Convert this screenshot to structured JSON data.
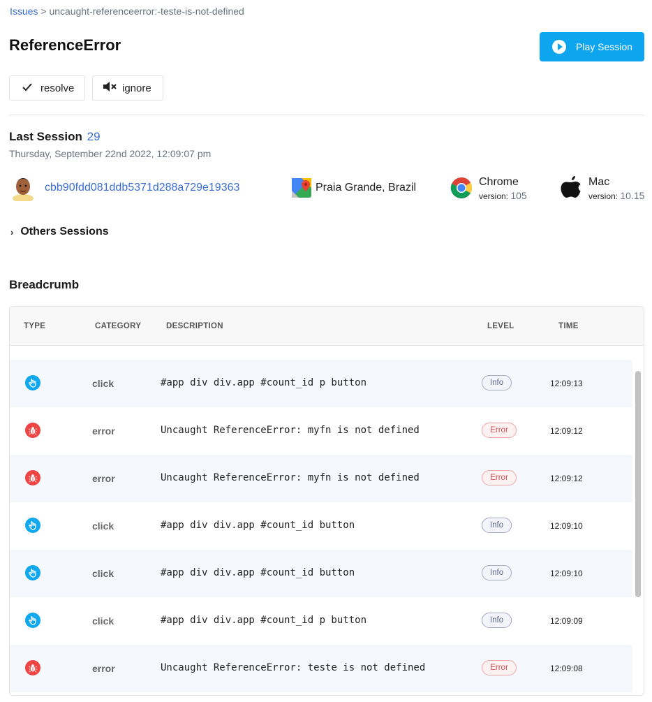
{
  "breadcrumb": {
    "root": "Issues",
    "separator": " > ",
    "current": "uncaught-referenceerror:-teste-is-not-defined"
  },
  "page_title": "ReferenceError",
  "header": {
    "play_label": "Play Session"
  },
  "actions": {
    "resolve_label": "resolve",
    "ignore_label": "ignore"
  },
  "session": {
    "heading": "Last Session",
    "count": "29",
    "date": "Thursday, September 22nd 2022, 12:09:07 pm",
    "user_id": "cbb90fdd081ddb5371d288a729e19363",
    "location": "Praia Grande, Brazil",
    "browser": {
      "name": "Chrome",
      "version_label": "version:",
      "version": "105"
    },
    "os": {
      "name": "Mac",
      "version_label": "version:",
      "version": "10.15"
    }
  },
  "others_label": "Others Sessions",
  "breadcrumb_section": {
    "title": "Breadcrumb",
    "columns": {
      "type": "TYPE",
      "category": "CATEGORY",
      "description": "DESCRIPTION",
      "level": "LEVEL",
      "time": "TIME"
    },
    "rows": [
      {
        "type": "click",
        "category": "click",
        "description": "#app div div.app #count_id p button",
        "level": "Info",
        "time": "12:09:13"
      },
      {
        "type": "error",
        "category": "error",
        "description": "Uncaught ReferenceError: myfn is not defined",
        "level": "Error",
        "time": "12:09:12"
      },
      {
        "type": "error",
        "category": "error",
        "description": "Uncaught ReferenceError: myfn is not defined",
        "level": "Error",
        "time": "12:09:12"
      },
      {
        "type": "click",
        "category": "click",
        "description": "#app div div.app #count_id button",
        "level": "Info",
        "time": "12:09:10"
      },
      {
        "type": "click",
        "category": "click",
        "description": "#app div div.app #count_id button",
        "level": "Info",
        "time": "12:09:10"
      },
      {
        "type": "click",
        "category": "click",
        "description": "#app div div.app #count_id p button",
        "level": "Info",
        "time": "12:09:09"
      },
      {
        "type": "error",
        "category": "error",
        "description": "Uncaught ReferenceError: teste is not defined",
        "level": "Error",
        "time": "12:09:08"
      }
    ]
  },
  "colors": {
    "accent": "#0ea5ef",
    "link": "#3b6fd4",
    "error": "#ef4444",
    "click": "#12a8ef"
  },
  "icons": {
    "play": "play-circle-icon",
    "resolve": "check-icon",
    "ignore": "mute-icon",
    "click": "hand-pointer-icon",
    "error": "bug-icon"
  }
}
